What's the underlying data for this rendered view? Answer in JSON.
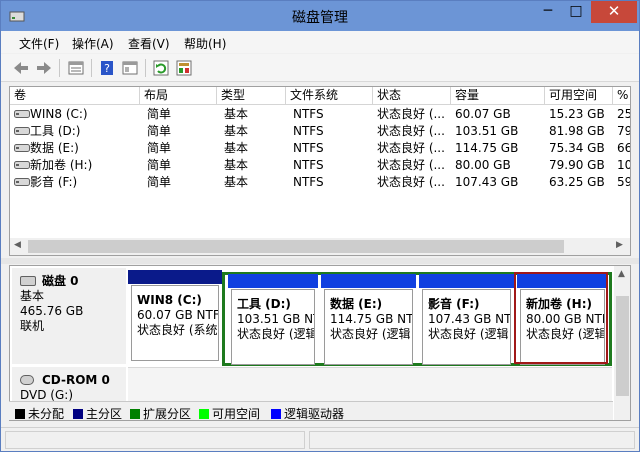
{
  "window": {
    "title": "磁盘管理",
    "minimize": "─",
    "maximize": "□",
    "close": "✕"
  },
  "menu": [
    "文件(F)",
    "操作(A)",
    "查看(V)",
    "帮助(H)"
  ],
  "toolbar_icons": [
    "back-arrow-icon",
    "forward-arrow-icon",
    "volume-list-icon",
    "help-icon",
    "properties-icon",
    "refresh-icon",
    "rescan-icon"
  ],
  "columns": [
    "卷",
    "布局",
    "类型",
    "文件系统",
    "状态",
    "容量",
    "可用空间",
    "%"
  ],
  "volumes": [
    {
      "name": "WIN8 (C:)",
      "layout": "简单",
      "type": "基本",
      "fs": "NTFS",
      "status": "状态良好 (...",
      "capacity": "60.07 GB",
      "free": "15.23 GB",
      "pct": "25"
    },
    {
      "name": "工具 (D:)",
      "layout": "简单",
      "type": "基本",
      "fs": "NTFS",
      "status": "状态良好 (...",
      "capacity": "103.51 GB",
      "free": "81.98 GB",
      "pct": "79"
    },
    {
      "name": "数据 (E:)",
      "layout": "简单",
      "type": "基本",
      "fs": "NTFS",
      "status": "状态良好 (...",
      "capacity": "114.75 GB",
      "free": "75.34 GB",
      "pct": "66"
    },
    {
      "name": "新加卷 (H:)",
      "layout": "简单",
      "type": "基本",
      "fs": "NTFS",
      "status": "状态良好 (...",
      "capacity": "80.00 GB",
      "free": "79.90 GB",
      "pct": "10"
    },
    {
      "name": "影音 (F:)",
      "layout": "简单",
      "type": "基本",
      "fs": "NTFS",
      "status": "状态良好 (...",
      "capacity": "107.43 GB",
      "free": "63.25 GB",
      "pct": "59"
    }
  ],
  "disk0": {
    "name": "磁盘 0",
    "type": "基本",
    "size": "465.76 GB",
    "status": "联机",
    "partitions": [
      {
        "name": "WIN8  (C:)",
        "size": "60.07 GB NTF",
        "status": "状态良好 (系统"
      },
      {
        "name": "工具  (D:)",
        "size": "103.51 GB NT",
        "status": "状态良好 (逻辑"
      },
      {
        "name": "数据  (E:)",
        "size": "114.75 GB NT",
        "status": "状态良好 (逻辑"
      },
      {
        "name": "影音  (F:)",
        "size": "107.43 GB NT",
        "status": "状态良好 (逻辑"
      },
      {
        "name": "新加卷  (H:)",
        "size": "80.00 GB NTF",
        "status": "状态良好 (逻辑"
      }
    ]
  },
  "cdrom0": {
    "name": "CD-ROM 0",
    "type": "DVD (G:)"
  },
  "legend": [
    {
      "label": "未分配",
      "color": "#000000"
    },
    {
      "label": "主分区",
      "color": "#000080"
    },
    {
      "label": "扩展分区",
      "color": "#008000"
    },
    {
      "label": "可用空间",
      "color": "#00ff00"
    },
    {
      "label": "逻辑驱动器",
      "color": "#0000ff"
    }
  ],
  "colors": {
    "primary_strip": "#0a1a8a",
    "logical_strip": "#1040e0",
    "extended_border": "#1e7a1e",
    "selected_border": "#a01818"
  }
}
